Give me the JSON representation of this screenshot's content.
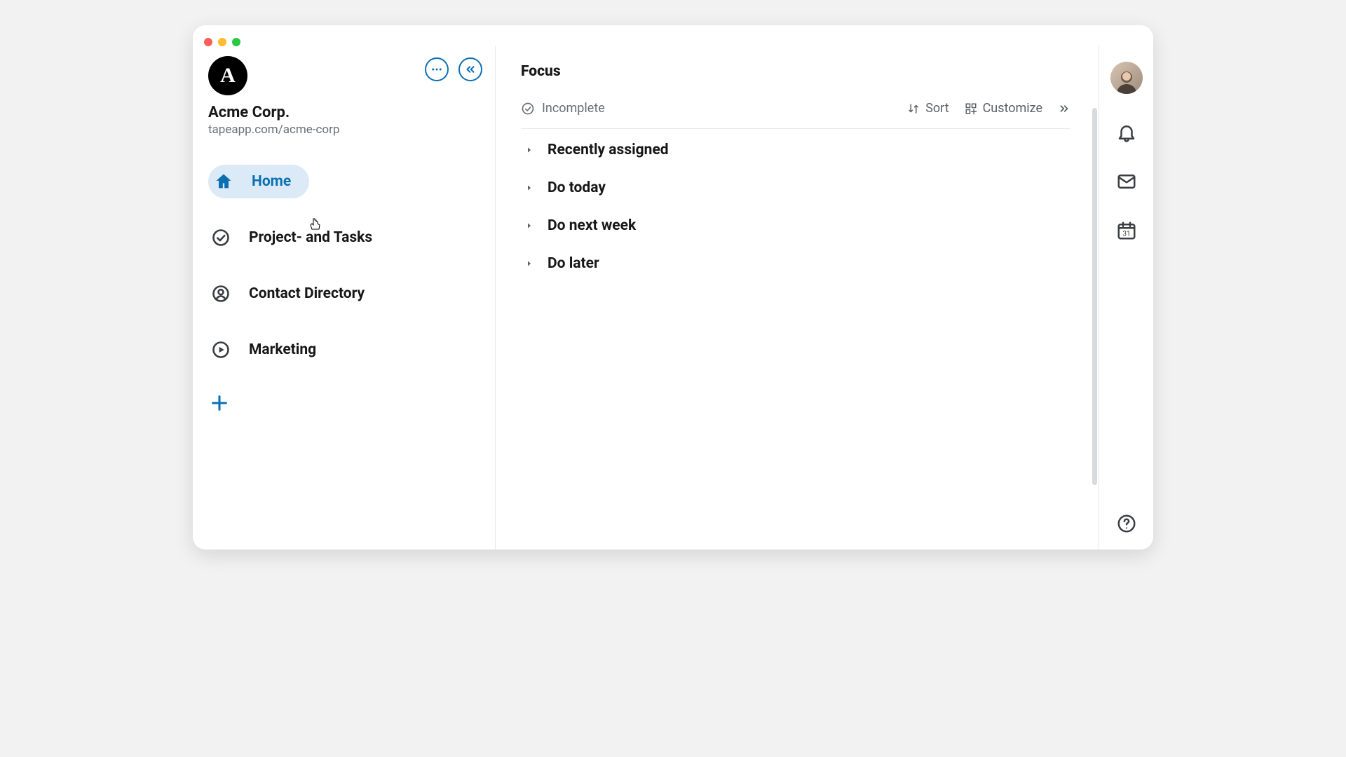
{
  "org": {
    "logo_letter": "A",
    "name": "Acme Corp.",
    "url": "tapeapp.com/acme-corp"
  },
  "sidebar": {
    "items": [
      {
        "label": "Home",
        "icon": "home",
        "active": true
      },
      {
        "label": "Project- and Tasks",
        "icon": "check-circle",
        "active": false
      },
      {
        "label": "Contact Directory",
        "icon": "person-circle",
        "active": false
      },
      {
        "label": "Marketing",
        "icon": "play-circle",
        "active": false
      }
    ]
  },
  "main": {
    "title": "Focus",
    "filter_label": "Incomplete",
    "sort_label": "Sort",
    "customize_label": "Customize",
    "sections": [
      {
        "title": "Recently assigned"
      },
      {
        "title": "Do today"
      },
      {
        "title": "Do next week"
      },
      {
        "title": "Do later"
      }
    ]
  },
  "rail": {
    "calendar_day": "31"
  }
}
